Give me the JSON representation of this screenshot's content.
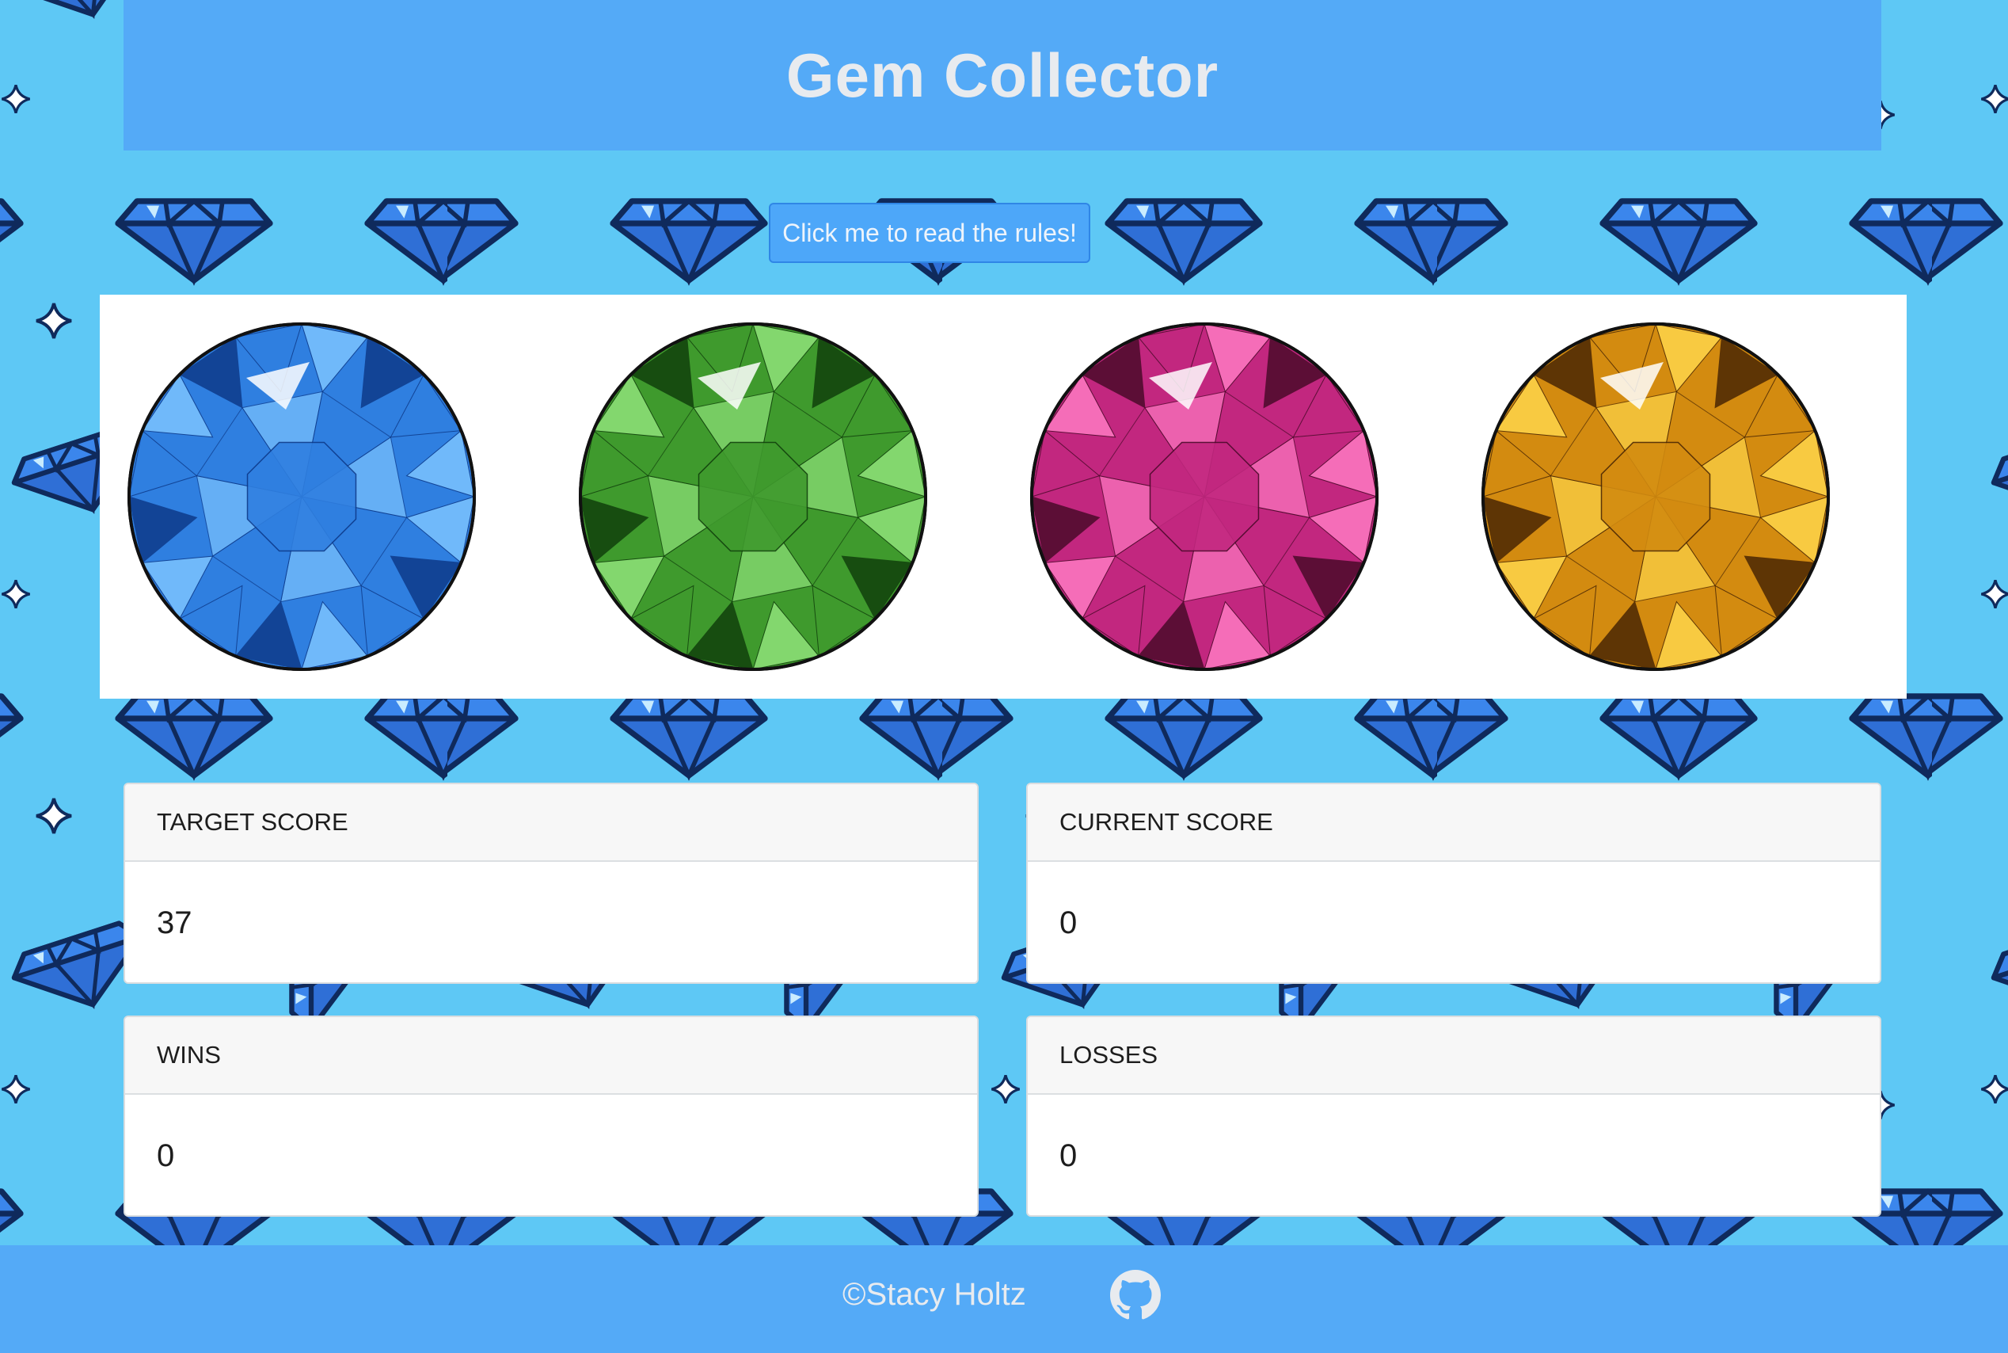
{
  "header": {
    "title": "Gem Collector"
  },
  "rules_button": {
    "label": "Click me to read the rules!"
  },
  "gems": [
    {
      "name": "blue gem",
      "color": "#2f7fe0",
      "light": "#7cc4ff",
      "dark": "#0d3a8a"
    },
    {
      "name": "green gem",
      "color": "#3f9a2d",
      "light": "#8fe27a",
      "dark": "#11400c"
    },
    {
      "name": "pink gem",
      "color": "#c2277f",
      "light": "#ff7ac2",
      "dark": "#4b0a2a"
    },
    {
      "name": "gold gem",
      "color": "#d38b10",
      "light": "#ffd54a",
      "dark": "#4a2704"
    }
  ],
  "scores": {
    "target": {
      "label": "TARGET SCORE",
      "value": "37"
    },
    "current": {
      "label": "CURRENT SCORE",
      "value": "0"
    },
    "wins": {
      "label": "WINS",
      "value": "0"
    },
    "losses": {
      "label": "LOSSES",
      "value": "0"
    }
  },
  "footer": {
    "credit": "©Stacy Holtz",
    "icon": "github-icon"
  },
  "colors": {
    "background": "#5ec8f5",
    "header": "#54aaf7",
    "diamond": "#2f6fd6",
    "diamond_outline": "#0f2a5c"
  }
}
